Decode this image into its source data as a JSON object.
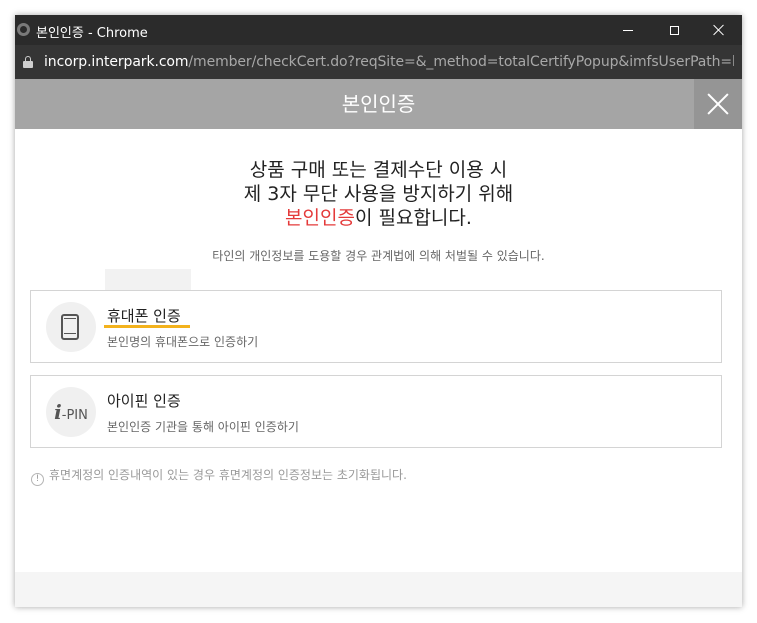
{
  "window": {
    "title": "본인인증 - Chrome",
    "controls": [
      "minimize",
      "maximize",
      "close"
    ]
  },
  "address": {
    "host": "incorp.interpark.com",
    "path": "/member/checkCert.do?reqSite=&_method=totalCertifyPopup&imfsUserPath=https%..."
  },
  "header": {
    "title": "본인인증"
  },
  "heading": {
    "line1": "상품 구매 또는 결제수단 이용 시",
    "line2": "제 3자 무단 사용을 방지하기 위해",
    "line3_highlight": "본인인증",
    "line3_rest": "이 필요합니다."
  },
  "notice": "타인의 개인정보를 도용할 경우 관계법에 의해 처벌될 수 있습니다.",
  "options": [
    {
      "title": "휴대폰 인증",
      "desc": "본인명의 휴대폰으로 인증하기",
      "icon": "phone-icon"
    },
    {
      "title": "아이핀 인증",
      "desc": "본인인증 기관을 통해 아이핀 인증하기",
      "icon": "ipin-icon",
      "icon_i": "i",
      "icon_pin": "-PIN"
    }
  ],
  "info": {
    "icon": "!",
    "text": "휴면계정의 인증내역이 있는 경우 휴면계정의 인증정보는 초기화됩니다."
  },
  "colors": {
    "header_bg": "#a5a5a5",
    "close_bg": "#959595",
    "highlight": "#e43a3a",
    "underline": "#f3b21d"
  }
}
